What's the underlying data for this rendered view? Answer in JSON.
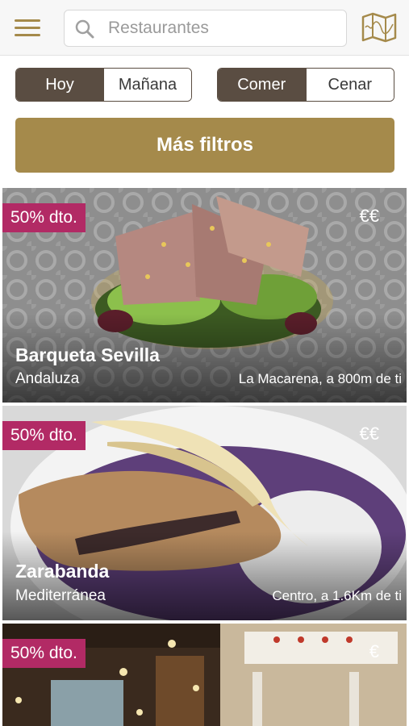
{
  "header": {
    "menu_icon": "hamburger-icon",
    "search_icon": "search-icon",
    "search_placeholder": "Restaurantes",
    "map_icon": "map-icon"
  },
  "day_toggle": {
    "options": [
      "Hoy",
      "Mañana"
    ],
    "selected": "Hoy"
  },
  "meal_toggle": {
    "options": [
      "Comer",
      "Cenar"
    ],
    "selected": "Comer"
  },
  "filters_button": "Más filtros",
  "colors": {
    "accent": "#a58a4b",
    "segment_active": "#5a4d42",
    "discount_badge": "#b22a65"
  },
  "restaurants": [
    {
      "discount": "50% dto.",
      "price": "€€",
      "name": "Barqueta Sevilla",
      "cuisine": "Andaluza",
      "location": "La Macarena, a 800m de ti"
    },
    {
      "discount": "50% dto.",
      "price": "€€",
      "name": "Zarabanda",
      "cuisine": "Mediterránea",
      "location": "Centro, a 1.6Km de ti"
    },
    {
      "discount": "50% dto.",
      "price": "€",
      "name": "",
      "cuisine": "",
      "location": ""
    }
  ]
}
